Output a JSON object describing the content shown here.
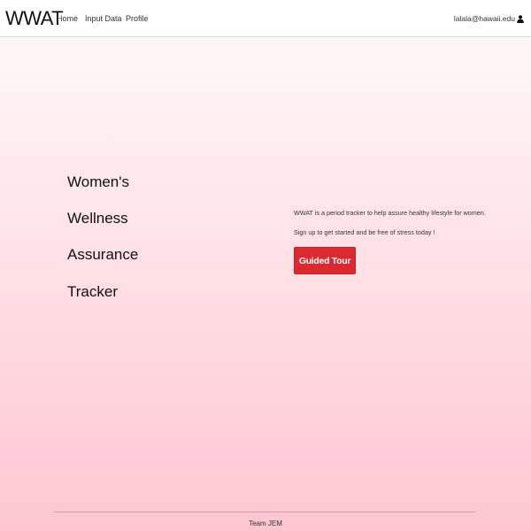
{
  "navbar": {
    "brand": "WWAT",
    "links": [
      "Home",
      "Input Data",
      "Profile"
    ],
    "user_email": "lalala@hawaii.edu",
    "user_icon": "user-icon"
  },
  "hero": {
    "title_words": [
      "Women's",
      "Wellness",
      "Assurance",
      "Tracker"
    ],
    "description": "WWAT is a period tracker to help assure healthy lifestyle for women.",
    "cta_text": "Sign up to get started and be free of stress today !",
    "tour_button": "Guided Tour"
  },
  "footer": {
    "text": "Team JEM"
  },
  "colors": {
    "accent": "#db2a2f",
    "background_top": "#fffafb",
    "background_bottom": "#ffc6cf"
  }
}
